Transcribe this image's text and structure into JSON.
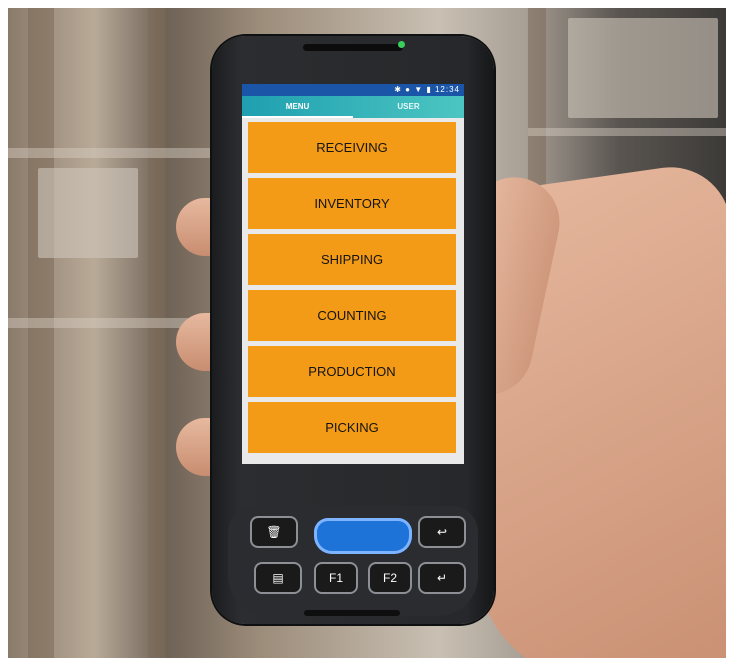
{
  "status_bar": {
    "time": "12:34"
  },
  "tabs": [
    {
      "label": "MENU",
      "selected": true
    },
    {
      "label": "USER",
      "selected": false
    }
  ],
  "menu": {
    "items": [
      "RECEIVING",
      "INVENTORY",
      "SHIPPING",
      "COUNTING",
      "PRODUCTION",
      "PICKING"
    ]
  },
  "keys": {
    "f1": "F1",
    "f2": "F2",
    "delete_icon": "trash-icon",
    "back_icon": "back-arrow-icon",
    "menu_icon": "menu-icon",
    "enter_icon": "enter-icon"
  },
  "colors": {
    "menu_item_bg": "#f39a16",
    "tab_bar": "#28b3b9",
    "status_bar": "#1b55a8",
    "scan_button": "#1e73d8"
  }
}
